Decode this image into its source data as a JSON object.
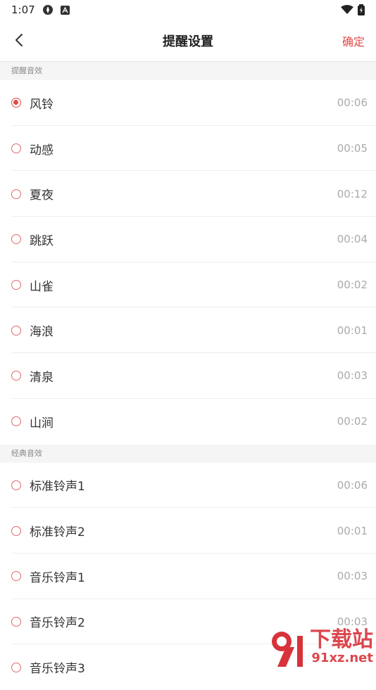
{
  "status": {
    "time": "1:07",
    "battery_glyph": "▮"
  },
  "nav": {
    "title": "提醒设置",
    "confirm": "确定"
  },
  "sections": [
    {
      "header": "提醒音效",
      "items": [
        {
          "label": "风铃",
          "duration": "00:06",
          "checked": true
        },
        {
          "label": "动感",
          "duration": "00:05"
        },
        {
          "label": "夏夜",
          "duration": "00:12"
        },
        {
          "label": "跳跃",
          "duration": "00:04"
        },
        {
          "label": "山雀",
          "duration": "00:02"
        },
        {
          "label": "海浪",
          "duration": "00:01"
        },
        {
          "label": "清泉",
          "duration": "00:03"
        },
        {
          "label": "山涧",
          "duration": "00:02"
        }
      ]
    },
    {
      "header": "经典音效",
      "items": [
        {
          "label": "标准铃声1",
          "duration": "00:06"
        },
        {
          "label": "标准铃声2",
          "duration": "00:01"
        },
        {
          "label": "音乐铃声1",
          "duration": "00:03"
        },
        {
          "label": "音乐铃声2",
          "duration": "00:03"
        },
        {
          "label": "音乐铃声3",
          "duration": ""
        }
      ]
    }
  ],
  "watermark": {
    "text": "下载站",
    "url": "91xz.net"
  },
  "colors": {
    "accent": "#e04a4a",
    "divider": "#eeeeee",
    "section_bg": "#f5f5f5"
  }
}
